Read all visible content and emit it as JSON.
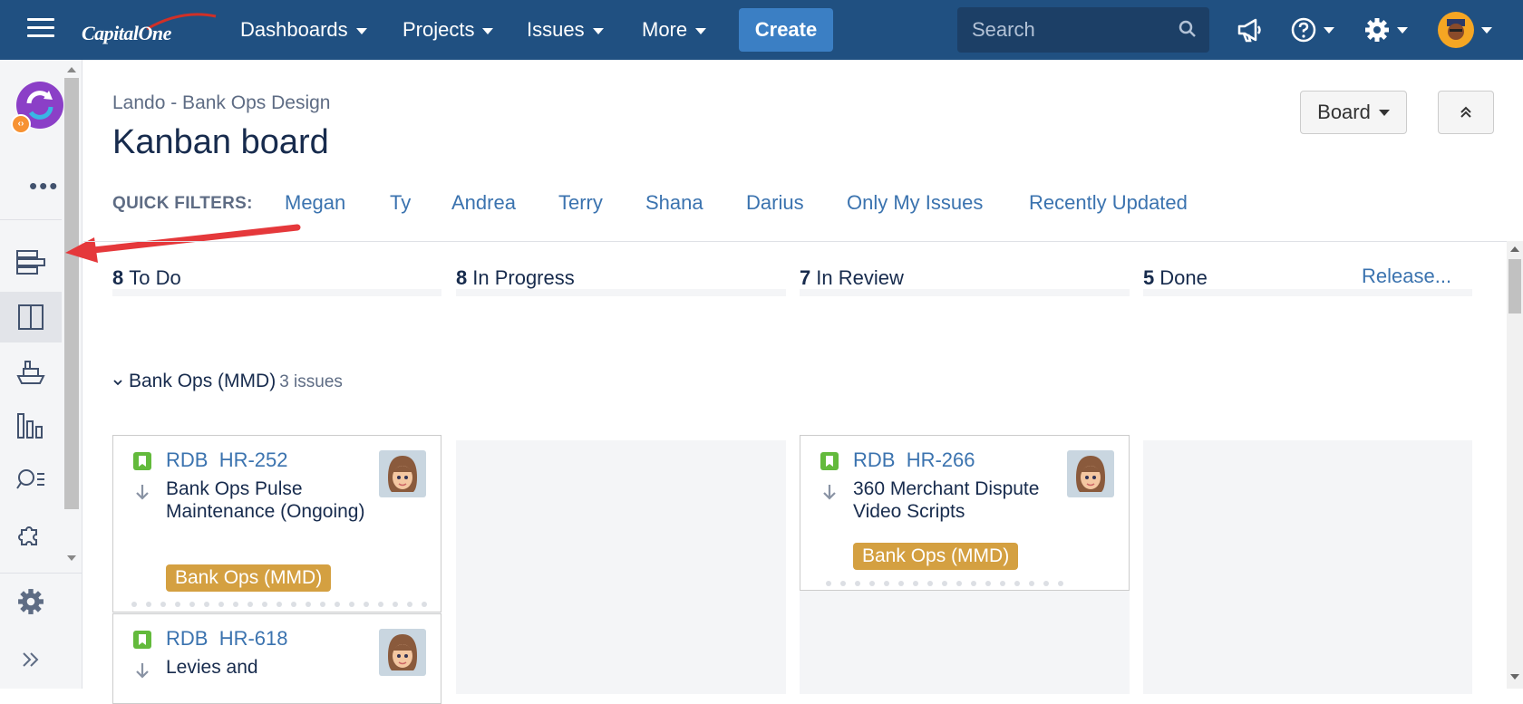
{
  "topnav": {
    "logo_text": "CapitalOne",
    "menus": [
      {
        "label": "Dashboards"
      },
      {
        "label": "Projects"
      },
      {
        "label": "Issues"
      },
      {
        "label": "More"
      }
    ],
    "create_label": "Create",
    "search_placeholder": "Search",
    "icons": [
      "menu-icon",
      "megaphone-icon",
      "help-icon",
      "gear-icon",
      "user-avatar"
    ]
  },
  "sidebar": {
    "items": [
      "backlog-icon",
      "board-icon",
      "releases-icon",
      "reports-icon",
      "issues-search-icon",
      "add-ons-icon"
    ],
    "active_item": "board-icon",
    "bottom": [
      "settings-icon",
      "expand-icon"
    ]
  },
  "header": {
    "breadcrumb": "Lando - Bank Ops Design",
    "title": "Kanban board",
    "board_button": "Board"
  },
  "quick_filters": {
    "label": "QUICK FILTERS:",
    "items": [
      "Megan",
      "Ty",
      "Andrea",
      "Terry",
      "Shana",
      "Darius",
      "Only My Issues",
      "Recently Updated"
    ]
  },
  "columns": [
    {
      "count": "8",
      "name": "To Do"
    },
    {
      "count": "8",
      "name": "In Progress"
    },
    {
      "count": "7",
      "name": "In Review"
    },
    {
      "count": "5",
      "name": "Done"
    }
  ],
  "release_link": "Release...",
  "swimlane": {
    "name": "Bank Ops (MMD)",
    "count": "3 issues"
  },
  "cards": [
    {
      "project": "RDB",
      "key": "HR-252",
      "summary": "Bank Ops Pulse Maintenance (Ongoing)",
      "epic": "Bank Ops (MMD)"
    },
    {
      "project": "RDB",
      "key": "HR-618",
      "summary": "Levies and",
      "epic": ""
    },
    {
      "project": "RDB",
      "key": "HR-266",
      "summary": "360 Merchant Dispute Video Scripts",
      "epic": "Bank Ops (MMD)"
    }
  ],
  "colors": {
    "nav_bg": "#205081",
    "create_bg": "#3b7fc4",
    "link": "#3b73af",
    "epic": "#d4a041",
    "story": "#63ba3c",
    "annotation_arrow": "#e5383b"
  }
}
